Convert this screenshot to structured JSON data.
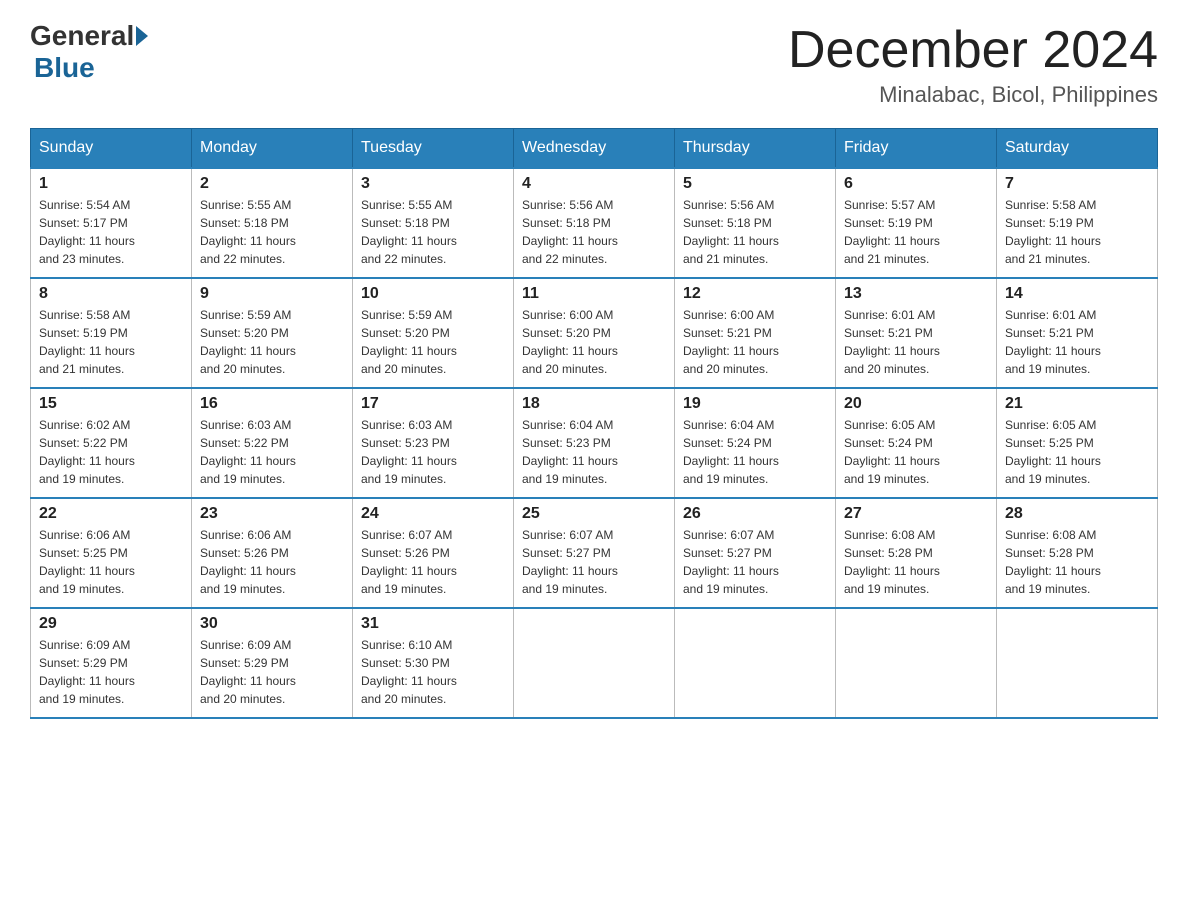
{
  "header": {
    "logo": {
      "text_general": "General",
      "text_blue": "Blue"
    },
    "title": "December 2024",
    "location": "Minalabac, Bicol, Philippines"
  },
  "days_of_week": [
    "Sunday",
    "Monday",
    "Tuesday",
    "Wednesday",
    "Thursday",
    "Friday",
    "Saturday"
  ],
  "weeks": [
    [
      {
        "day": "1",
        "sunrise": "5:54 AM",
        "sunset": "5:17 PM",
        "daylight": "11 hours and 23 minutes."
      },
      {
        "day": "2",
        "sunrise": "5:55 AM",
        "sunset": "5:18 PM",
        "daylight": "11 hours and 22 minutes."
      },
      {
        "day": "3",
        "sunrise": "5:55 AM",
        "sunset": "5:18 PM",
        "daylight": "11 hours and 22 minutes."
      },
      {
        "day": "4",
        "sunrise": "5:56 AM",
        "sunset": "5:18 PM",
        "daylight": "11 hours and 22 minutes."
      },
      {
        "day": "5",
        "sunrise": "5:56 AM",
        "sunset": "5:18 PM",
        "daylight": "11 hours and 21 minutes."
      },
      {
        "day": "6",
        "sunrise": "5:57 AM",
        "sunset": "5:19 PM",
        "daylight": "11 hours and 21 minutes."
      },
      {
        "day": "7",
        "sunrise": "5:58 AM",
        "sunset": "5:19 PM",
        "daylight": "11 hours and 21 minutes."
      }
    ],
    [
      {
        "day": "8",
        "sunrise": "5:58 AM",
        "sunset": "5:19 PM",
        "daylight": "11 hours and 21 minutes."
      },
      {
        "day": "9",
        "sunrise": "5:59 AM",
        "sunset": "5:20 PM",
        "daylight": "11 hours and 20 minutes."
      },
      {
        "day": "10",
        "sunrise": "5:59 AM",
        "sunset": "5:20 PM",
        "daylight": "11 hours and 20 minutes."
      },
      {
        "day": "11",
        "sunrise": "6:00 AM",
        "sunset": "5:20 PM",
        "daylight": "11 hours and 20 minutes."
      },
      {
        "day": "12",
        "sunrise": "6:00 AM",
        "sunset": "5:21 PM",
        "daylight": "11 hours and 20 minutes."
      },
      {
        "day": "13",
        "sunrise": "6:01 AM",
        "sunset": "5:21 PM",
        "daylight": "11 hours and 20 minutes."
      },
      {
        "day": "14",
        "sunrise": "6:01 AM",
        "sunset": "5:21 PM",
        "daylight": "11 hours and 19 minutes."
      }
    ],
    [
      {
        "day": "15",
        "sunrise": "6:02 AM",
        "sunset": "5:22 PM",
        "daylight": "11 hours and 19 minutes."
      },
      {
        "day": "16",
        "sunrise": "6:03 AM",
        "sunset": "5:22 PM",
        "daylight": "11 hours and 19 minutes."
      },
      {
        "day": "17",
        "sunrise": "6:03 AM",
        "sunset": "5:23 PM",
        "daylight": "11 hours and 19 minutes."
      },
      {
        "day": "18",
        "sunrise": "6:04 AM",
        "sunset": "5:23 PM",
        "daylight": "11 hours and 19 minutes."
      },
      {
        "day": "19",
        "sunrise": "6:04 AM",
        "sunset": "5:24 PM",
        "daylight": "11 hours and 19 minutes."
      },
      {
        "day": "20",
        "sunrise": "6:05 AM",
        "sunset": "5:24 PM",
        "daylight": "11 hours and 19 minutes."
      },
      {
        "day": "21",
        "sunrise": "6:05 AM",
        "sunset": "5:25 PM",
        "daylight": "11 hours and 19 minutes."
      }
    ],
    [
      {
        "day": "22",
        "sunrise": "6:06 AM",
        "sunset": "5:25 PM",
        "daylight": "11 hours and 19 minutes."
      },
      {
        "day": "23",
        "sunrise": "6:06 AM",
        "sunset": "5:26 PM",
        "daylight": "11 hours and 19 minutes."
      },
      {
        "day": "24",
        "sunrise": "6:07 AM",
        "sunset": "5:26 PM",
        "daylight": "11 hours and 19 minutes."
      },
      {
        "day": "25",
        "sunrise": "6:07 AM",
        "sunset": "5:27 PM",
        "daylight": "11 hours and 19 minutes."
      },
      {
        "day": "26",
        "sunrise": "6:07 AM",
        "sunset": "5:27 PM",
        "daylight": "11 hours and 19 minutes."
      },
      {
        "day": "27",
        "sunrise": "6:08 AM",
        "sunset": "5:28 PM",
        "daylight": "11 hours and 19 minutes."
      },
      {
        "day": "28",
        "sunrise": "6:08 AM",
        "sunset": "5:28 PM",
        "daylight": "11 hours and 19 minutes."
      }
    ],
    [
      {
        "day": "29",
        "sunrise": "6:09 AM",
        "sunset": "5:29 PM",
        "daylight": "11 hours and 19 minutes."
      },
      {
        "day": "30",
        "sunrise": "6:09 AM",
        "sunset": "5:29 PM",
        "daylight": "11 hours and 20 minutes."
      },
      {
        "day": "31",
        "sunrise": "6:10 AM",
        "sunset": "5:30 PM",
        "daylight": "11 hours and 20 minutes."
      },
      null,
      null,
      null,
      null
    ]
  ],
  "labels": {
    "sunrise": "Sunrise:",
    "sunset": "Sunset:",
    "daylight": "Daylight:"
  }
}
